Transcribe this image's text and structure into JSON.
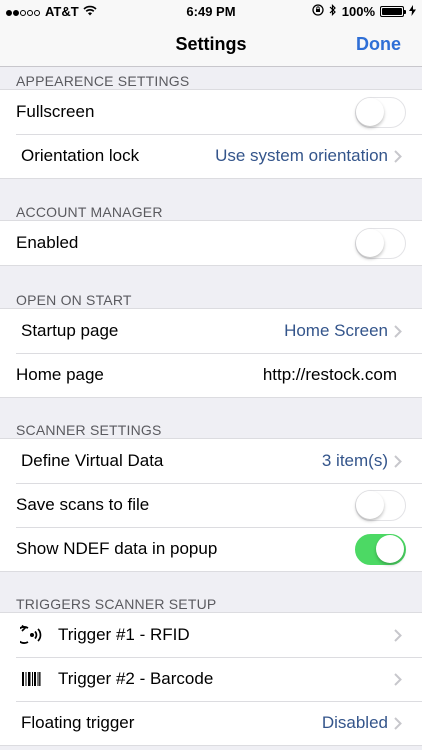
{
  "status": {
    "carrier": "AT&T",
    "time": "6:49 PM",
    "battery": "100%"
  },
  "nav": {
    "title": "Settings",
    "done": "Done"
  },
  "sections": {
    "appearance": {
      "header": "APPEARENCE SETTINGS",
      "fullscreen": "Fullscreen",
      "fullscreen_on": false,
      "orientation_label": "Orientation lock",
      "orientation_value": "Use system orientation"
    },
    "account": {
      "header": "ACCOUNT MANAGER",
      "enabled": "Enabled",
      "enabled_on": false
    },
    "open_on_start": {
      "header": "OPEN ON START",
      "startup_label": "Startup page",
      "startup_value": "Home Screen",
      "home_label": "Home page",
      "home_value": "http://restock.com"
    },
    "scanner": {
      "header": "SCANNER SETTINGS",
      "virtual_label": "Define Virtual Data",
      "virtual_value": "3 item(s)",
      "save_label": "Save scans to file",
      "save_on": false,
      "ndef_label": "Show NDEF data in popup",
      "ndef_on": true
    },
    "triggers": {
      "header": "TRIGGERS SCANNER SETUP",
      "trigger1": "Trigger #1 - RFID",
      "trigger1_icon": "rfid-icon",
      "trigger2": "Trigger #2 - Barcode",
      "trigger2_icon": "barcode-icon",
      "floating_label": "Floating trigger",
      "floating_value": "Disabled"
    }
  },
  "colors": {
    "accent": "#2f6fd6",
    "value_text": "#34558b",
    "toggle_on": "#4cd964",
    "background": "#efeff4"
  }
}
